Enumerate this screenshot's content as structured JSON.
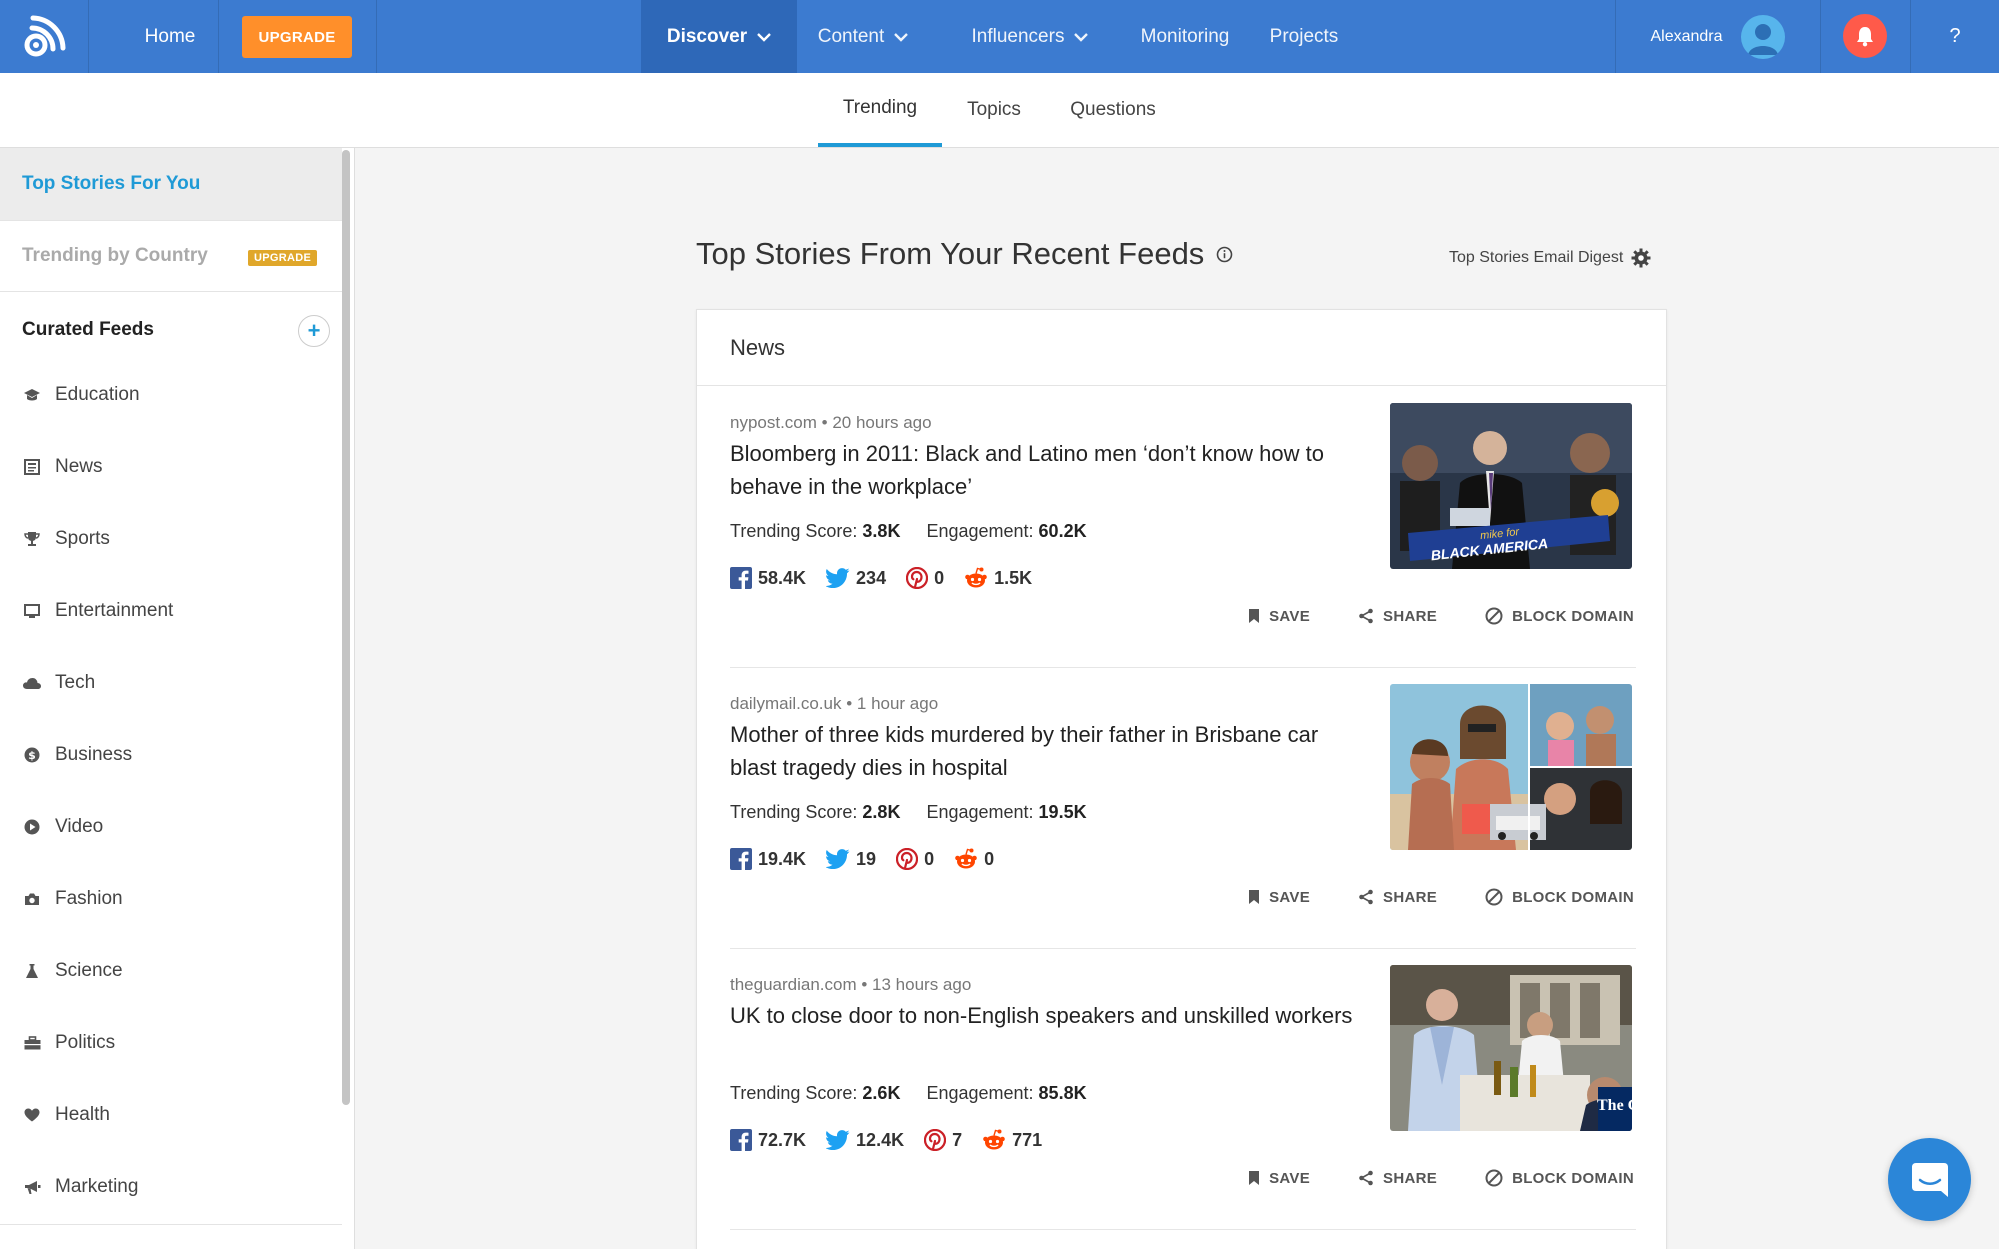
{
  "topnav": {
    "home": "Home",
    "upgrade": "UPGRADE",
    "discover": "Discover",
    "content": "Content",
    "influencers": "Influencers",
    "monitoring": "Monitoring",
    "projects": "Projects",
    "user_name": "Alexandra",
    "help": "?"
  },
  "subtabs": [
    "Trending",
    "Topics",
    "Questions"
  ],
  "sidebar": {
    "top_stories": "Top Stories For You",
    "trending_country": "Trending by Country",
    "upgrade_badge": "UPGRADE",
    "curated_feeds": "Curated Feeds",
    "add": "+",
    "items": [
      {
        "label": "Education",
        "icon": "graduation-cap-icon"
      },
      {
        "label": "News",
        "icon": "newspaper-icon"
      },
      {
        "label": "Sports",
        "icon": "trophy-icon"
      },
      {
        "label": "Entertainment",
        "icon": "monitor-icon"
      },
      {
        "label": "Tech",
        "icon": "cloud-icon"
      },
      {
        "label": "Business",
        "icon": "dollar-icon"
      },
      {
        "label": "Video",
        "icon": "play-icon"
      },
      {
        "label": "Fashion",
        "icon": "camera-icon"
      },
      {
        "label": "Science",
        "icon": "flask-icon"
      },
      {
        "label": "Politics",
        "icon": "briefcase-icon"
      },
      {
        "label": "Health",
        "icon": "heart-icon"
      },
      {
        "label": "Marketing",
        "icon": "megaphone-icon"
      }
    ]
  },
  "main": {
    "title": "Top Stories From Your Recent Feeds",
    "digest": "Top Stories Email Digest",
    "section": "News",
    "trending_label": "Trending Score:",
    "engagement_label": "Engagement:",
    "actions": {
      "save": "SAVE",
      "share": "SHARE",
      "block": "BLOCK DOMAIN"
    },
    "stories": [
      {
        "meta": "nypost.com • 20 hours ago",
        "headline": "Bloomberg in 2011: Black and Latino men ‘don’t know how to behave in the workplace’",
        "trending": "3.8K",
        "engagement": "60.2K",
        "facebook": "58.4K",
        "twitter": "234",
        "pinterest": "0",
        "reddit": "1.5K",
        "thumb_text": "BLACK AMERICA",
        "thumb_small": "mike for"
      },
      {
        "meta": "dailymail.co.uk • 1 hour ago",
        "headline": "Mother of three kids murdered by their father in Brisbane car blast tragedy dies in hospital",
        "trending": "2.8K",
        "engagement": "19.5K",
        "facebook": "19.4K",
        "twitter": "19",
        "pinterest": "0",
        "reddit": "0"
      },
      {
        "meta": "theguardian.com • 13 hours ago",
        "headline": "UK to close door to non-English speakers and unskilled workers",
        "trending": "2.6K",
        "engagement": "85.8K",
        "facebook": "72.7K",
        "twitter": "12.4K",
        "pinterest": "7",
        "reddit": "771",
        "thumb_text": "The Gu"
      }
    ]
  },
  "colors": {
    "nav": "#3c7bd0",
    "nav_active": "#2e68b8",
    "upgrade": "#ff8f2a",
    "accent": "#1f9ad6",
    "bell": "#ff5a4a",
    "badge": "#e0a72a"
  }
}
